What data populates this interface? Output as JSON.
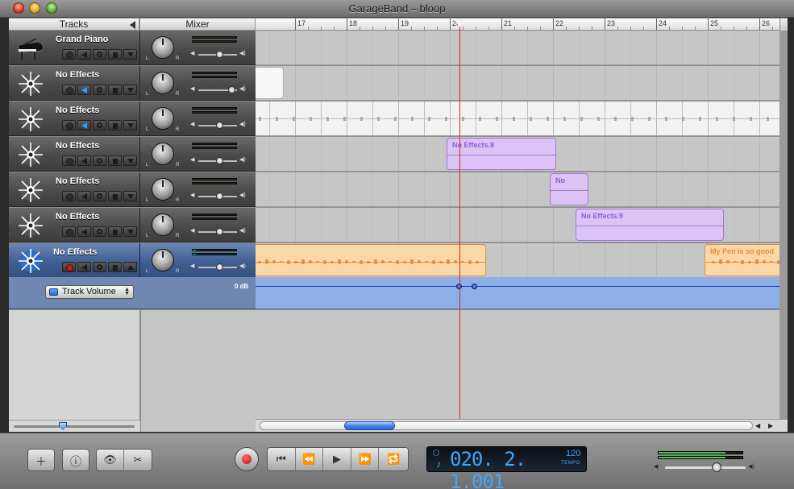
{
  "window": {
    "title": "GarageBand – bloop"
  },
  "headers": {
    "tracks_label": "Tracks",
    "mixer_label": "Mixer"
  },
  "ruler": {
    "bars": [
      "17",
      "18",
      "19",
      "20",
      "21",
      "22",
      "23",
      "24",
      "25",
      "26"
    ]
  },
  "tracks": [
    {
      "name": "Grand Piano",
      "icon": "grand-piano-icon",
      "volume": 0.55,
      "selected": false
    },
    {
      "name": "No Effects",
      "icon": "star-burst-icon",
      "volume": 0.85,
      "selected": false
    },
    {
      "name": "No Effects",
      "icon": "star-burst-icon",
      "volume": 0.55,
      "selected": false
    },
    {
      "name": "No Effects",
      "icon": "star-burst-icon",
      "volume": 0.55,
      "selected": false
    },
    {
      "name": "No Effects",
      "icon": "star-burst-icon",
      "volume": 0.55,
      "selected": false
    },
    {
      "name": "No Effects",
      "icon": "star-burst-icon",
      "volume": 0.55,
      "selected": false
    },
    {
      "name": "No Effects",
      "icon": "star-burst-icon",
      "volume": 0.55,
      "selected": true
    }
  ],
  "regions": [
    {
      "label": "No Effects.8"
    },
    {
      "label": "No"
    },
    {
      "label": "No Effects.9"
    },
    {
      "label": "My Pen is so good"
    }
  ],
  "automation": {
    "selector_label": "Track Volume",
    "level_label": "0 dB"
  },
  "transport": {
    "lcd_time": "020. 2. 1.001",
    "tempo_value": "120",
    "tempo_label": "TEMPO"
  },
  "colors": {
    "accent_blue": "#3fa7ff",
    "region_violet": "#dcc3f6",
    "region_orange": "#fbd6a6",
    "playhead_red": "#d12a2a"
  }
}
